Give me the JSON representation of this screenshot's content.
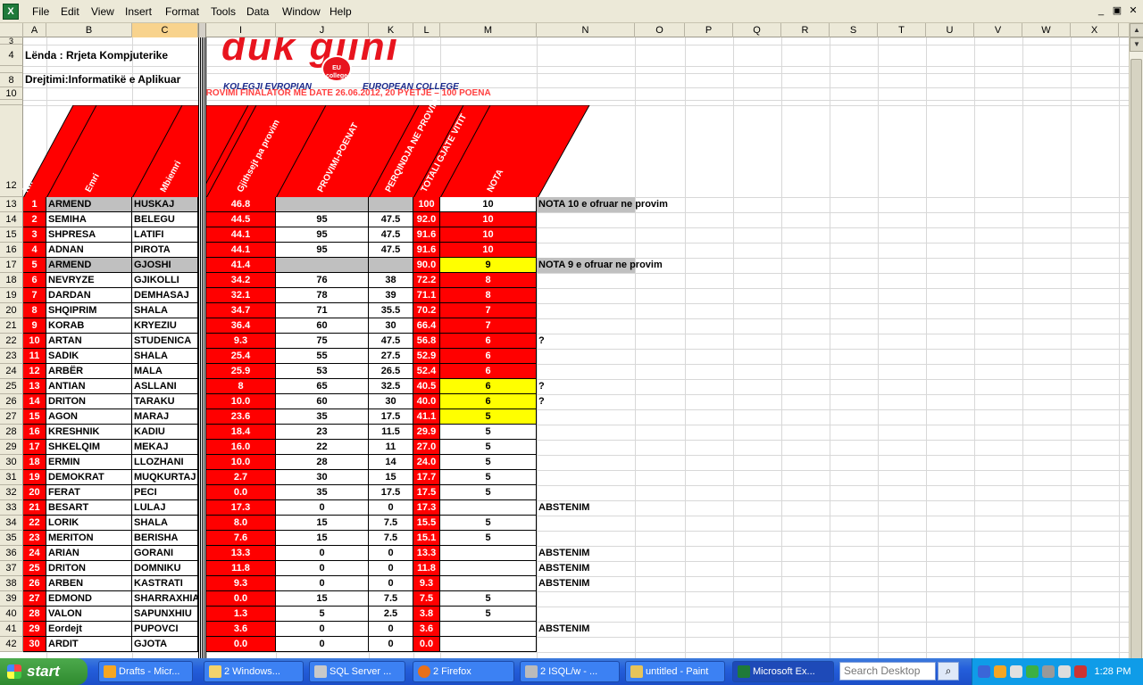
{
  "menu": [
    "File",
    "Edit",
    "View",
    "Insert",
    "Format",
    "Tools",
    "Data",
    "Window",
    "Help"
  ],
  "window_controls": [
    "_",
    "▣",
    "✕"
  ],
  "columns": [
    "A",
    "B",
    "C",
    "I",
    "J",
    "K",
    "L",
    "M",
    "N",
    "O",
    "P",
    "Q",
    "R",
    "S",
    "T",
    "U",
    "V",
    "W",
    "X"
  ],
  "header_rows": {
    "course": "Lënda : Rrjeta Kompjuterike",
    "program": "Drejtimi:Informatikë e Aplikuar",
    "logo_text": "duk gjini",
    "logo_badge": "EU college",
    "college_left": "KOLEGJI EVROPIAN",
    "college_right": "EUROPEAN COLLEGE",
    "exam_title": "PROVIMI FINALATOR ME DATE 26.06.2012, 20 PYETJE – 100 POENA"
  },
  "col_titles": {
    "nr": "Nr.",
    "emri": "Emri",
    "mbiemri": "Mbiemri",
    "gjithsej": "Gjithsejt pa provim",
    "provimi": "PROVIMI-POENAT",
    "perqindja": "PERQINDJA NE PROVIM",
    "totali": "TOTALI GJATE VITIT",
    "nota": "NOTA"
  },
  "rows": [
    {
      "r": "13",
      "nr": "1",
      "emri": "ARMEND",
      "mbiemri": "HUSKAJ",
      "i": "46.8",
      "j": "",
      "k": "",
      "l": "100",
      "m": "10",
      "n": "NOTA 10 e ofruar ne provim",
      "style": "gray",
      "mstyle": "white"
    },
    {
      "r": "14",
      "nr": "2",
      "emri": "SEMIHA",
      "mbiemri": "BELEGU",
      "i": "44.5",
      "j": "95",
      "k": "47.5",
      "l": "92.0",
      "m": "10",
      "n": "",
      "style": "white",
      "mstyle": "red"
    },
    {
      "r": "15",
      "nr": "3",
      "emri": "SHPRESA",
      "mbiemri": "LATIFI",
      "i": "44.1",
      "j": "95",
      "k": "47.5",
      "l": "91.6",
      "m": "10",
      "n": "",
      "style": "white",
      "mstyle": "red"
    },
    {
      "r": "16",
      "nr": "4",
      "emri": "ADNAN",
      "mbiemri": "PIROTA",
      "i": "44.1",
      "j": "95",
      "k": "47.5",
      "l": "91.6",
      "m": "10",
      "n": "",
      "style": "white",
      "mstyle": "red"
    },
    {
      "r": "17",
      "nr": "5",
      "emri": "ARMEND",
      "mbiemri": "GJOSHI",
      "i": "41.4",
      "j": "",
      "k": "",
      "l": "90.0",
      "m": "9",
      "n": "NOTA 9 e ofruar ne provim",
      "style": "gray",
      "mstyle": "yellow"
    },
    {
      "r": "18",
      "nr": "6",
      "emri": "NEVRYZE",
      "mbiemri": "GJIKOLLI",
      "i": "34.2",
      "j": "76",
      "k": "38",
      "l": "72.2",
      "m": "8",
      "n": "",
      "style": "white",
      "mstyle": "red"
    },
    {
      "r": "19",
      "nr": "7",
      "emri": "DARDAN",
      "mbiemri": "DEMHASAJ",
      "i": "32.1",
      "j": "78",
      "k": "39",
      "l": "71.1",
      "m": "8",
      "n": "",
      "style": "white",
      "mstyle": "red"
    },
    {
      "r": "20",
      "nr": "8",
      "emri": "SHQIPRIM",
      "mbiemri": "SHALA",
      "i": "34.7",
      "j": "71",
      "k": "35.5",
      "l": "70.2",
      "m": "7",
      "n": "",
      "style": "white",
      "mstyle": "red"
    },
    {
      "r": "21",
      "nr": "9",
      "emri": "KORAB",
      "mbiemri": "KRYEZIU",
      "i": "36.4",
      "j": "60",
      "k": "30",
      "l": "66.4",
      "m": "7",
      "n": "",
      "style": "white",
      "mstyle": "red"
    },
    {
      "r": "22",
      "nr": "10",
      "emri": "ARTAN",
      "mbiemri": "STUDENICA",
      "i": "9.3",
      "j": "75",
      "k": "47.5",
      "l": "56.8",
      "m": "6",
      "n": "?",
      "style": "white",
      "mstyle": "red"
    },
    {
      "r": "23",
      "nr": "11",
      "emri": "SADIK",
      "mbiemri": "SHALA",
      "i": "25.4",
      "j": "55",
      "k": "27.5",
      "l": "52.9",
      "m": "6",
      "n": "",
      "style": "white",
      "mstyle": "red"
    },
    {
      "r": "24",
      "nr": "12",
      "emri": "ARBËR",
      "mbiemri": "MALA",
      "i": "25.9",
      "j": "53",
      "k": "26.5",
      "l": "52.4",
      "m": "6",
      "n": "",
      "style": "white",
      "mstyle": "red"
    },
    {
      "r": "25",
      "nr": "13",
      "emri": "ANTIAN",
      "mbiemri": "ASLLANI",
      "i": "8",
      "j": "65",
      "k": "32.5",
      "l": "40.5",
      "m": "6",
      "n": "?",
      "style": "white",
      "mstyle": "yellow"
    },
    {
      "r": "26",
      "nr": "14",
      "emri": "DRITON",
      "mbiemri": "TARAKU",
      "i": "10.0",
      "j": "60",
      "k": "30",
      "l": "40.0",
      "m": "6",
      "n": "?",
      "style": "white",
      "mstyle": "yellow"
    },
    {
      "r": "27",
      "nr": "15",
      "emri": "AGON",
      "mbiemri": "MARAJ",
      "i": "23.6",
      "j": "35",
      "k": "17.5",
      "l": "41.1",
      "m": "5",
      "n": "",
      "style": "white",
      "mstyle": "yellow"
    },
    {
      "r": "28",
      "nr": "16",
      "emri": "KRESHNIK",
      "mbiemri": "KADIU",
      "i": "18.4",
      "j": "23",
      "k": "11.5",
      "l": "29.9",
      "m": "5",
      "n": "",
      "style": "white",
      "mstyle": "white"
    },
    {
      "r": "29",
      "nr": "17",
      "emri": "SHKELQIM",
      "mbiemri": "MEKAJ",
      "i": "16.0",
      "j": "22",
      "k": "11",
      "l": "27.0",
      "m": "5",
      "n": "",
      "style": "white",
      "mstyle": "white"
    },
    {
      "r": "30",
      "nr": "18",
      "emri": "ERMIN",
      "mbiemri": "LLOZHANI",
      "i": "10.0",
      "j": "28",
      "k": "14",
      "l": "24.0",
      "m": "5",
      "n": "",
      "style": "white",
      "mstyle": "white"
    },
    {
      "r": "31",
      "nr": "19",
      "emri": "DEMOKRAT",
      "mbiemri": "MUQKURTAJ",
      "i": "2.7",
      "j": "30",
      "k": "15",
      "l": "17.7",
      "m": "5",
      "n": "",
      "style": "white",
      "mstyle": "white"
    },
    {
      "r": "32",
      "nr": "20",
      "emri": "FERAT",
      "mbiemri": "PECI",
      "i": "0.0",
      "j": "35",
      "k": "17.5",
      "l": "17.5",
      "m": "5",
      "n": "",
      "style": "white",
      "mstyle": "white"
    },
    {
      "r": "33",
      "nr": "21",
      "emri": "BESART",
      "mbiemri": "LULAJ",
      "i": "17.3",
      "j": "0",
      "k": "0",
      "l": "17.3",
      "m": "",
      "n": "ABSTENIM",
      "style": "white",
      "mstyle": "white"
    },
    {
      "r": "34",
      "nr": "22",
      "emri": "LORIK",
      "mbiemri": "SHALA",
      "i": "8.0",
      "j": "15",
      "k": "7.5",
      "l": "15.5",
      "m": "5",
      "n": "",
      "style": "white",
      "mstyle": "white"
    },
    {
      "r": "35",
      "nr": "23",
      "emri": "MERITON",
      "mbiemri": "BERISHA",
      "i": "7.6",
      "j": "15",
      "k": "7.5",
      "l": "15.1",
      "m": "5",
      "n": "",
      "style": "white",
      "mstyle": "white"
    },
    {
      "r": "36",
      "nr": "24",
      "emri": "ARIAN",
      "mbiemri": "GORANI",
      "i": "13.3",
      "j": "0",
      "k": "0",
      "l": "13.3",
      "m": "",
      "n": "ABSTENIM",
      "style": "white",
      "mstyle": "white"
    },
    {
      "r": "37",
      "nr": "25",
      "emri": "DRITON",
      "mbiemri": "DOMNIKU",
      "i": "11.8",
      "j": "0",
      "k": "0",
      "l": "11.8",
      "m": "",
      "n": "ABSTENIM",
      "style": "white",
      "mstyle": "white"
    },
    {
      "r": "38",
      "nr": "26",
      "emri": "ARBEN",
      "mbiemri": "KASTRATI",
      "i": "9.3",
      "j": "0",
      "k": "0",
      "l": "9.3",
      "m": "",
      "n": "ABSTENIM",
      "style": "white",
      "mstyle": "white"
    },
    {
      "r": "39",
      "nr": "27",
      "emri": "EDMOND",
      "mbiemri": "SHARRAXHIA",
      "i": "0.0",
      "j": "15",
      "k": "7.5",
      "l": "7.5",
      "m": "5",
      "n": "",
      "style": "white",
      "mstyle": "white"
    },
    {
      "r": "40",
      "nr": "28",
      "emri": "VALON",
      "mbiemri": "SAPUNXHIU",
      "i": "1.3",
      "j": "5",
      "k": "2.5",
      "l": "3.8",
      "m": "5",
      "n": "",
      "style": "white",
      "mstyle": "white"
    },
    {
      "r": "41",
      "nr": "29",
      "emri": "Eordejt",
      "mbiemri": "PUPOVCI",
      "i": "3.6",
      "j": "0",
      "k": "0",
      "l": "3.6",
      "m": "",
      "n": "ABSTENIM",
      "style": "white",
      "mstyle": "white"
    },
    {
      "r": "42",
      "nr": "30",
      "emri": "ARDIT",
      "mbiemri": "GJOTA",
      "i": "0.0",
      "j": "0",
      "k": "0",
      "l": "0.0",
      "m": "",
      "n": "",
      "style": "white",
      "mstyle": "white"
    }
  ],
  "taskbar": {
    "start": "start",
    "tasks": [
      "Drafts - Micr...",
      "2 Windows...",
      "SQL Server ...",
      "2 Firefox",
      "2 ISQL/w - ...",
      "untitled - Paint",
      "Microsoft Ex..."
    ],
    "search_placeholder": "Search Desktop",
    "clock": "1:28 PM"
  },
  "colors": {
    "red": "#ff0000",
    "yellow": "#ffff00",
    "gray": "#c0c0c0",
    "selected_col": "#f8d38d"
  }
}
